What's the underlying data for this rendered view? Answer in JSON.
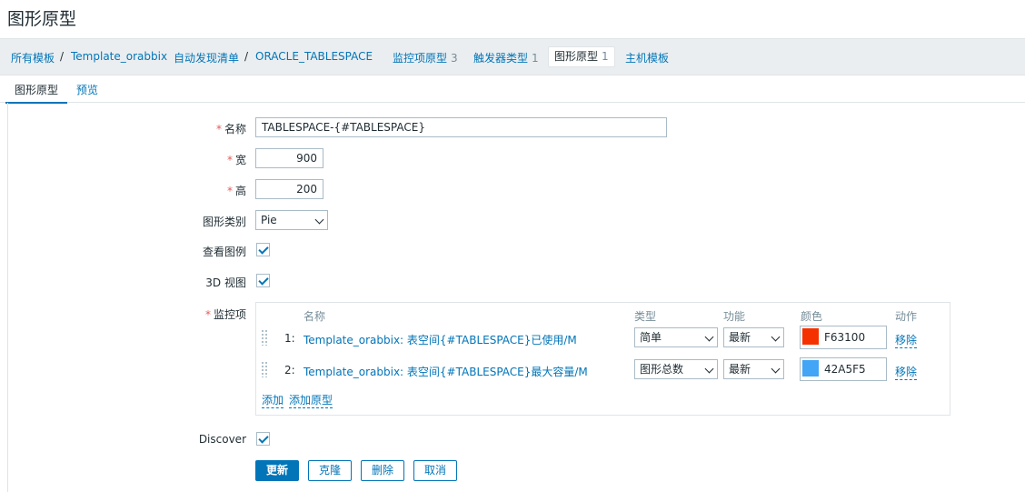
{
  "title": "图形原型",
  "breadcrumb": {
    "all_templates": "所有模板",
    "template": "Template_orabbix",
    "discovery": "自动发现清单",
    "rule": "ORACLE_TABLESPACE",
    "item_proto": "监控项原型",
    "item_proto_count": "3",
    "trigger_proto": "触发器类型",
    "trigger_proto_count": "1",
    "graph_proto": "图形原型",
    "graph_proto_count": "1",
    "host_proto": "主机模板",
    "separator": "/"
  },
  "tabs": {
    "graph": "图形原型",
    "preview": "预览"
  },
  "form": {
    "name_label": "名称",
    "name_value": "TABLESPACE-{#TABLESPACE}",
    "width_label": "宽",
    "width_value": "900",
    "height_label": "高",
    "height_value": "200",
    "type_label": "图形类别",
    "type_value": "Pie",
    "legend_label": "查看图例",
    "view3d_label": "3D 视图",
    "items_label": "监控项",
    "discover_label": "Discover",
    "required_mark": "*"
  },
  "items": {
    "headers": {
      "name": "名称",
      "type": "类型",
      "func": "功能",
      "color": "颜色",
      "action": "动作"
    },
    "rows": [
      {
        "num": "1:",
        "name": "Template_orabbix: 表空间{#TABLESPACE}已使用/M",
        "type": "简单",
        "func": "最新",
        "color": "F63100",
        "hex": "#F63100",
        "action": "移除"
      },
      {
        "num": "2:",
        "name": "Template_orabbix: 表空间{#TABLESPACE}最大容量/M",
        "type": "图形总数",
        "func": "最新",
        "color": "42A5F5",
        "hex": "#42A5F5",
        "action": "移除"
      }
    ],
    "add": "添加",
    "add_proto": "添加原型"
  },
  "buttons": {
    "update": "更新",
    "clone": "克隆",
    "delete": "删除",
    "cancel": "取消"
  }
}
